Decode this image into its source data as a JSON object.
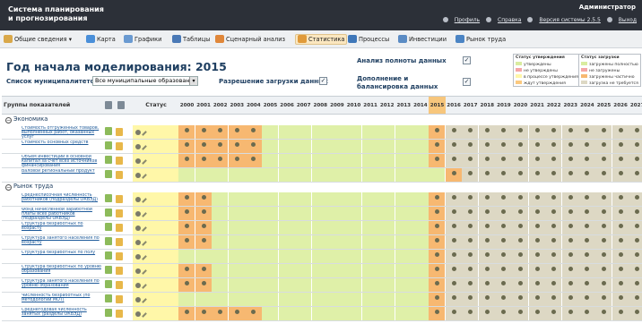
{
  "header": {
    "app_title_line1": "Система планирования",
    "app_title_line2": "и прогнозирования",
    "user": "Администратор",
    "links": [
      "Профиль",
      "Справка",
      "Версия системы 2.5.5",
      "Выход"
    ]
  },
  "menu": [
    {
      "label": "Общие сведения",
      "icon": "folder-icon",
      "caret": "▾",
      "color": "#d9a84a"
    },
    {
      "label": "Карта",
      "icon": "map-icon",
      "color": "#4a8fd9"
    },
    {
      "label": "Графики",
      "icon": "chart-line-icon",
      "color": "#6a9ad1"
    },
    {
      "label": "Таблицы",
      "icon": "table-icon",
      "color": "#4a79b6"
    },
    {
      "label": "Сценарный анализ",
      "icon": "scenario-icon",
      "color": "#e0873a"
    },
    {
      "label": "Статистика",
      "icon": "statistics-icon",
      "color": "#e09a3a",
      "active": true
    },
    {
      "label": "Процессы",
      "icon": "process-icon",
      "color": "#3f77b9"
    },
    {
      "label": "Инвестиции",
      "icon": "investment-icon",
      "color": "#5a8bc4"
    },
    {
      "label": "Рынок труда",
      "icon": "labor-market-icon",
      "color": "#4b84c4"
    }
  ],
  "page": {
    "title": "Год начала моделирования: 2015",
    "muni_label": "Список муниципалитетов:",
    "muni_value": "Все муниципальные образован",
    "upload_permission_label": "Разрешение загрузки данных",
    "completeness_label": "Анализ полноты данных",
    "balancing_label": "Дополнение и балансировка данных"
  },
  "legend": {
    "approval_title": "Статус утверждения",
    "approval": [
      {
        "label": "утверждены",
        "color": "#d9ec9f"
      },
      {
        "label": "не утверждены",
        "color": "#f5a6a6"
      },
      {
        "label": "в процессе утверждения",
        "color": "#fff7a8"
      },
      {
        "label": "ждут утверждения",
        "color": "#fbc97f"
      }
    ],
    "load_title": "Статус загрузки",
    "load": [
      {
        "label": "загружены полностью",
        "color": "#d9ec9f"
      },
      {
        "label": "не загружены",
        "color": "#f5a6a6"
      },
      {
        "label": "загружены частично",
        "color": "#f7b871"
      },
      {
        "label": "загрузка не требуется",
        "color": "#ddd8c4"
      }
    ]
  },
  "grid": {
    "col_groups": "Группы показателей",
    "col_status": "Статус",
    "years": [
      "2000",
      "2001",
      "2002",
      "2003",
      "2004",
      "2005",
      "2006",
      "2007",
      "2008",
      "2009",
      "2010",
      "2011",
      "2012",
      "2013",
      "2014",
      "2015",
      "2016",
      "2017",
      "2018",
      "2019",
      "2020",
      "2021",
      "2022",
      "2023",
      "2024",
      "2025",
      "2026",
      "2027"
    ],
    "highlight_year": "2015",
    "colors": {
      "orange": "#f7b871",
      "green": "#dff0a8",
      "tan": "#ddd8c4",
      "white": "#ffffff"
    },
    "rows": [
      {
        "type": "group",
        "label": "Экономика",
        "toggle": "−"
      },
      {
        "type": "item",
        "label": "Стоимость отгруженных товаров, выполненных работ, оказанных услуг",
        "cells": "OOOOOGGGGGGGGGGOTTTTTTTTTTTT",
        "dots": "1111100000000001111111111111"
      },
      {
        "type": "item",
        "label": "Стоимость основных средств",
        "cells": "OOOOOGGGGGGGGGGOTTTTTTTTTTTT",
        "dots": "1111100000000001111111111111"
      },
      {
        "type": "item",
        "label": "Объем инвестиций в основной капитал за счет всех источников финансирования",
        "cells": "OOOOOGGGGGGGGGGOTTTTTTTTTTTT",
        "dots": "1111100000000001111111111111"
      },
      {
        "type": "item",
        "label": "Валовой региональный продукт",
        "cells": "GGGGGGGGGGGGGGGGOTTTTTTTTTTT",
        "dots": "0000000000000000111111111111"
      },
      {
        "type": "group",
        "label": "Рынок труда",
        "toggle": "−"
      },
      {
        "type": "item",
        "label": "Среднесписочная численность работников (подразделы ОКВЭД)",
        "cells": "OOGGGGGGGGGGGGGOTTTTTTTTTTTT",
        "dots": "1100000000000001111111111111"
      },
      {
        "type": "item",
        "label": "Фонд начисленной заработной платы всех работников (подразделы ОКВЭД)",
        "cells": "OOGGGGGGGGGGGGGOTTTTTTTTTTTT",
        "dots": "1100000000000001111111111111"
      },
      {
        "type": "item",
        "label": "Структура безработных по возрасту",
        "cells": "OOGGGGGGGGGGGGGOTTTTTTTTTTTT",
        "dots": "1100000000000001111111111111"
      },
      {
        "type": "item",
        "label": "Структура занятого населения по возрасту",
        "cells": "OOGGGGGGGGGGGGGOTTTTTTTTTTTT",
        "dots": "1100000000000001111111111111"
      },
      {
        "type": "item",
        "label": "Структура безработных по полу",
        "cells": "GGGGGGGGGGGGGGGOTTTTTTTTTTTT",
        "dots": "0000000000000001111111111111"
      },
      {
        "type": "item",
        "label": "Структура безработных по уровню образования",
        "cells": "OOGGGGGGGGGGGGGOTTTTTTTTTTTT",
        "dots": "1100000000000001111111111111"
      },
      {
        "type": "item",
        "label": "Структура занятого населения по уровню образования",
        "cells": "OOGGGGGGGGGGGGGOTTTTTTTTTTTT",
        "dots": "1100000000000001111111111111"
      },
      {
        "type": "item",
        "label": "Численность безработных (по методологии МОТ)",
        "cells": "GGGGGGGGGGGGGGGOTTTTTTTTTTTT",
        "dots": "0000000000000001111111111111"
      },
      {
        "type": "item",
        "label": "Среднегодовая численность занятых (разделы ОКВЭД)",
        "cells": "OOOOOGGGGGGGGGGOTTTTTTTTTTTT",
        "dots": "1111100000000001111111111111"
      }
    ]
  }
}
